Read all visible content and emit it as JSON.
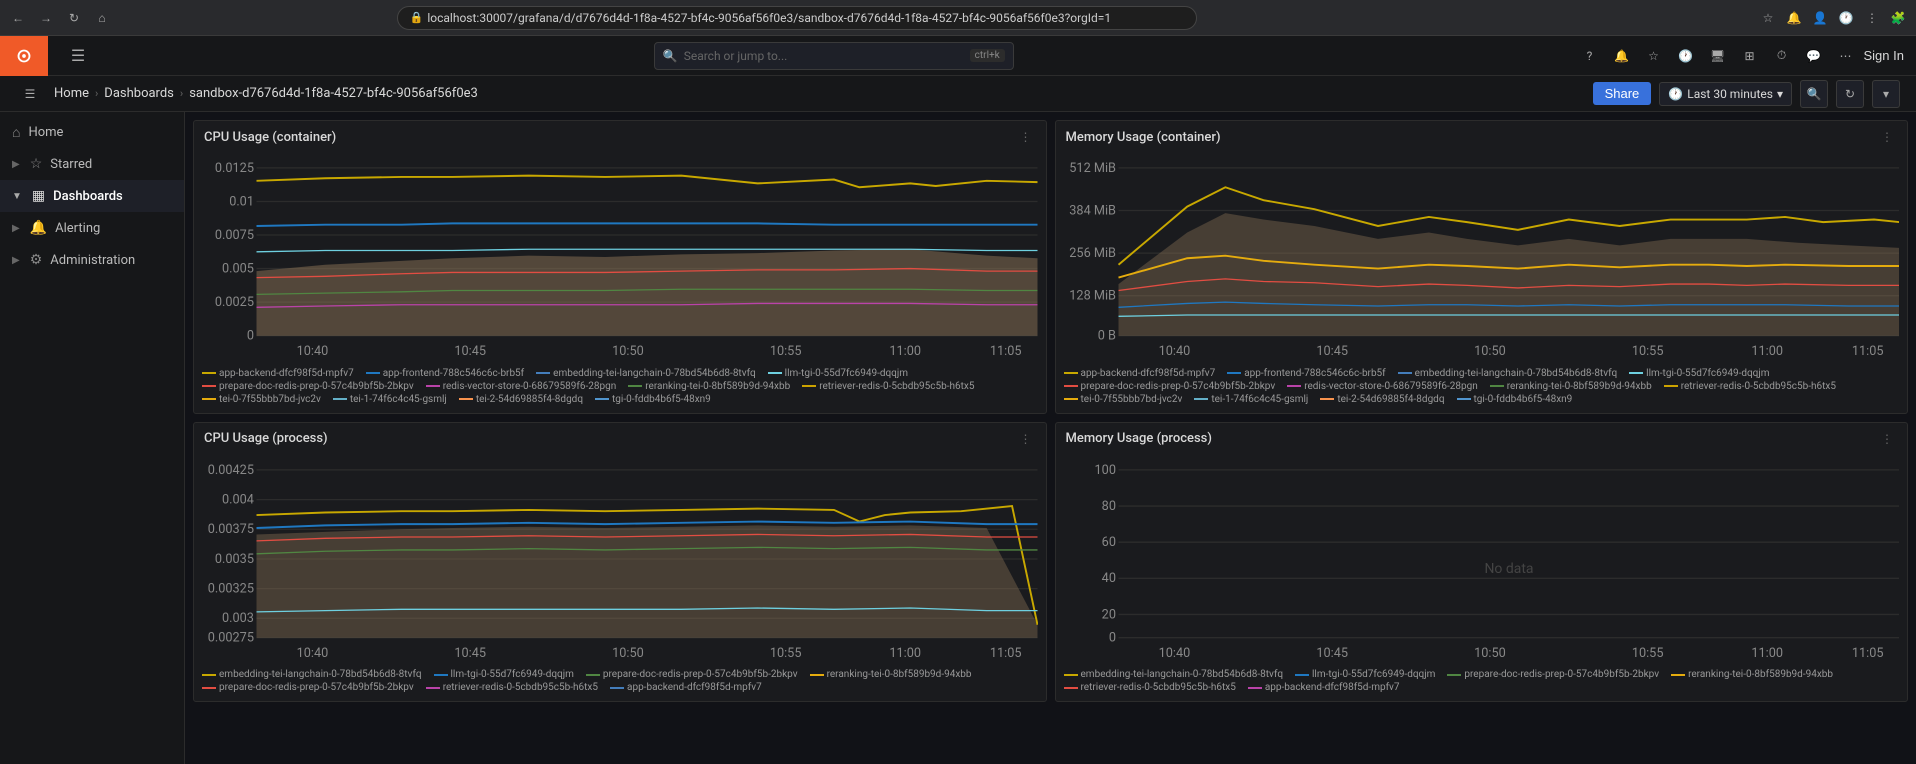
{
  "browser": {
    "url": "localhost:30007/grafana/d/d7676d4d-1f8a-4527-bf4c-9056af56f0e3/sandbox-d7676d4d-1f8a-4527-bf4c-9056af56f0e3?orgId=1"
  },
  "header": {
    "search_placeholder": "Search or jump to...",
    "search_shortcut": "ctrl+k",
    "sign_in": "Sign In"
  },
  "breadcrumb": {
    "home": "Home",
    "dashboards": "Dashboards",
    "current": "sandbox-d7676d4d-1f8a-4527-bf4c-9056af56f0e3",
    "share": "Share",
    "time_range": "Last 30 minutes"
  },
  "sidebar": {
    "items": [
      {
        "id": "home",
        "label": "Home",
        "icon": "⌂"
      },
      {
        "id": "starred",
        "label": "Starred",
        "icon": "☆"
      },
      {
        "id": "dashboards",
        "label": "Dashboards",
        "icon": "▦",
        "active": true
      },
      {
        "id": "alerting",
        "label": "Alerting",
        "icon": "🔔"
      },
      {
        "id": "administration",
        "label": "Administration",
        "icon": "⚙"
      }
    ]
  },
  "panels": {
    "cpu_container": {
      "title": "CPU Usage (container)",
      "y_labels": [
        "0.0125",
        "0.01",
        "0.0075",
        "0.005",
        "0.0025",
        "0"
      ],
      "x_labels": [
        "10:40",
        "10:45",
        "10:50",
        "10:55",
        "11:00",
        "11:05"
      ],
      "legend": [
        {
          "color": "#c8a800",
          "label": "app-backend-dfcf98f5d-mpfv7"
        },
        {
          "color": "#1f78c1",
          "label": "app-frontend-788c546c6c-brb5f"
        },
        {
          "color": "#447ebc",
          "label": "embedding-tei-langchain-0-78bd54b6d8-8tvfq"
        },
        {
          "color": "#6ed0e0",
          "label": "llm-tgi-0-55d7fc6949-dqqjm"
        },
        {
          "color": "#e24d42",
          "label": "prepare-doc-redis-prep-0-57c4b9bf5b-2bkpv"
        },
        {
          "color": "#ba43a9",
          "label": "redis-vector-store-0-68679589f6-28pgn"
        },
        {
          "color": "#508642",
          "label": "reranking-tei-0-8bf589b9d-94xbb"
        },
        {
          "color": "#cca300",
          "label": "retriever-redis-0-5cbdb95c5b-h6tx5"
        },
        {
          "color": "#e5ac0e",
          "label": "tei-0-7f55bbb7bd-jvc2v"
        },
        {
          "color": "#64b0c8",
          "label": "tei-1-74f6c4c45-gsmlj"
        },
        {
          "color": "#f9934e",
          "label": "tei-2-54d69885f4-8dgdq"
        },
        {
          "color": "#5195ce",
          "label": "tgi-0-fddb4b6f5-48xn9"
        }
      ]
    },
    "memory_container": {
      "title": "Memory Usage (container)",
      "y_labels": [
        "512 MiB",
        "384 MiB",
        "256 MiB",
        "128 MiB",
        "0 B"
      ],
      "x_labels": [
        "10:40",
        "10:45",
        "10:50",
        "10:55",
        "11:00",
        "11:05"
      ],
      "legend": [
        {
          "color": "#c8a800",
          "label": "app-backend-dfcf98f5d-mpfv7"
        },
        {
          "color": "#1f78c1",
          "label": "app-frontend-788c546c6c-brb5f"
        },
        {
          "color": "#447ebc",
          "label": "embedding-tei-langchain-0-78bd54b6d8-8tvfq"
        },
        {
          "color": "#6ed0e0",
          "label": "llm-tgi-0-55d7fc6949-dqqjm"
        },
        {
          "color": "#e24d42",
          "label": "prepare-doc-redis-prep-0-57c4b9bf5b-2bkpv"
        },
        {
          "color": "#ba43a9",
          "label": "redis-vector-store-0-68679589f6-28pgn"
        },
        {
          "color": "#508642",
          "label": "reranking-tei-0-8bf589b9d-94xbb"
        },
        {
          "color": "#cca300",
          "label": "retriever-redis-0-5cbdb95c5b-h6tx5"
        },
        {
          "color": "#e5ac0e",
          "label": "tei-0-7f55bbb7bd-jvc2v"
        },
        {
          "color": "#64b0c8",
          "label": "tei-1-74f6c4c45-gsmlj"
        },
        {
          "color": "#f9934e",
          "label": "tei-2-54d69885f4-8dgdq"
        },
        {
          "color": "#5195ce",
          "label": "tgi-0-fddb4b6f5-48xn9"
        }
      ]
    },
    "cpu_process": {
      "title": "CPU Usage (process)",
      "y_labels": [
        "0.00425",
        "0.004",
        "0.00375",
        "0.0035",
        "0.00325",
        "0.003",
        "0.00275"
      ],
      "x_labels": [
        "10:40",
        "10:45",
        "10:50",
        "10:55",
        "11:00",
        "11:05"
      ],
      "legend": [
        {
          "color": "#c8a800",
          "label": "embedding-tei-langchain-0-78bd54b6d8-8tvfq"
        },
        {
          "color": "#1f78c1",
          "label": "llm-tgi-0-55d7fc6949-dqqjm"
        },
        {
          "color": "#508642",
          "label": "prepare-doc-redis-prep-0-57c4b9bf5b-2bkpv"
        },
        {
          "color": "#e5ac0e",
          "label": "reranking-tei-0-8bf589b9d-94xbb"
        },
        {
          "color": "#e24d42",
          "label": "prepare-doc-redis-prep-0-57c4b9bf5b-2bkpv"
        },
        {
          "color": "#ba43a9",
          "label": "retriever-redis-0-5cbdb95c5b-h6tx5"
        },
        {
          "color": "#447ebc",
          "label": "app-backend-dfcf98f5d-mpfv7"
        }
      ]
    },
    "memory_process": {
      "title": "Memory Usage (process)",
      "y_labels": [
        "100",
        "80",
        "60",
        "40",
        "20",
        "0"
      ],
      "x_labels": [
        "10:40",
        "10:45",
        "10:50",
        "10:55",
        "11:00",
        "11:05"
      ],
      "legend": [
        {
          "color": "#c8a800",
          "label": "embedding-tei-langchain-0-78bd54b6d8-8tvfq"
        },
        {
          "color": "#1f78c1",
          "label": "llm-tgi-0-55d7fc6949-dqqjm"
        },
        {
          "color": "#508642",
          "label": "prepare-doc-redis-prep-0-57c4b9bf5b-2bkpv"
        },
        {
          "color": "#e5ac0e",
          "label": "reranking-tei-0-8bf589b9d-94xbb"
        },
        {
          "color": "#e24d42",
          "label": "retriever-redis-0-5cbdb95c5b-h6tx5"
        },
        {
          "color": "#ba43a9",
          "label": "app-backend-dfcf98f5d-mpfv7"
        }
      ]
    }
  }
}
